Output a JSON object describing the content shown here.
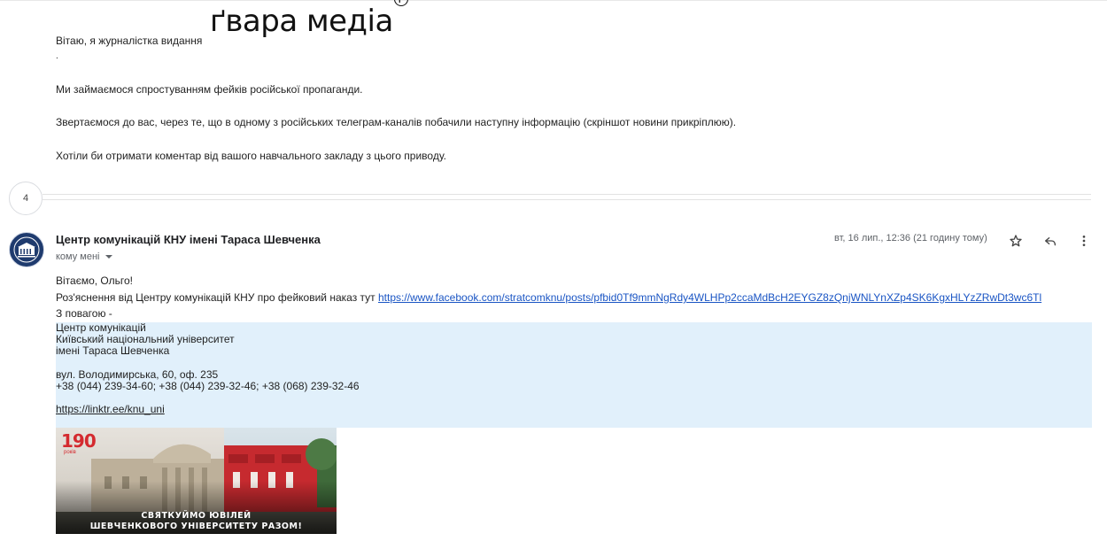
{
  "quoted": {
    "greeting": "Вітаю, я журналістка видання",
    "logo_text": "ґвара медіа",
    "logo_mark": "ґ",
    "dot": ".",
    "line1": "Ми займаємося спростуванням фейків російської пропаганди.",
    "line2": "Звертаємося до вас, через те, що в одному з російських телеграм-каналів побачили наступну інформацію (скріншот новини прикріплюю).",
    "line3": "Хотіли би отримати коментар від вашого навчального закладу з цього приводу."
  },
  "thread": {
    "collapsed_count": "4"
  },
  "message": {
    "sender": "Центр комунікацій КНУ імені Тараса Шевченка",
    "recipient": "кому мені",
    "date": "вт, 16 лип., 12:36 (21 годину тому)",
    "greeting": "Вітаємо, Ольго!",
    "explanation": "Роз'яснення від Центру комунікацій КНУ про фейковий наказ тут ",
    "link": "https://www.facebook.com/stratcomknu/posts/pfbid0Tf9mmNgRdy4WLHPp2ccaMdBcH2EYGZ8zQnjWNLYnXZp4SK6KgxHLYzZRwDt3wc6Tl",
    "regards": "З повагою -"
  },
  "signature": {
    "line1": "Центр комунікацій",
    "line2": "Київський національний університет",
    "line3": "імені Тараса Шевченка",
    "address": "вул. Володимирська, 60, оф. 235",
    "phones": "+38 (044) 239-34-60; +38 (044) 239-32-46; +38 (068) 239-32-46",
    "link": "https://linktr.ee/knu_uni"
  },
  "banner": {
    "number": "190",
    "years": "років",
    "line1": "СВЯТКУЙМО ЮВІЛЕЙ",
    "line2": "ШЕВЧЕНКОВОГО УНІВЕРСИТЕТУ РАЗОМ!"
  },
  "icons": {
    "star": "star-icon",
    "reply": "reply-icon",
    "more": "more-vert-icon",
    "dropdown": "chevron-down-icon"
  }
}
